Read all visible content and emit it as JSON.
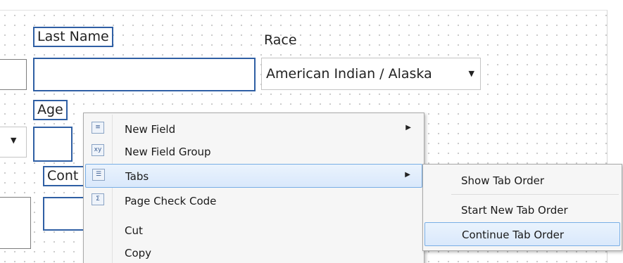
{
  "form": {
    "last_name_label": "Last Name",
    "race_label": "Race",
    "race_value": "American Indian / Alaska",
    "age_label": "Age",
    "contact_label_partial": "Cont"
  },
  "context_menu": {
    "items": [
      {
        "label": "New Field",
        "icon": "new-field-icon",
        "submenu": true
      },
      {
        "label": "New Field Group",
        "icon": "new-field-group-icon",
        "submenu": false
      },
      {
        "label": "Tabs",
        "icon": "tabs-icon",
        "submenu": true,
        "highlighted": true
      },
      {
        "label": "Page Check Code",
        "icon": "page-check-code-icon",
        "submenu": false
      },
      {
        "label": "Cut",
        "icon": "",
        "submenu": false
      },
      {
        "label": "Copy",
        "icon": "",
        "submenu": false
      }
    ]
  },
  "tabs_submenu": {
    "items": [
      {
        "label": "Show Tab Order"
      },
      {
        "label": "Start New Tab Order"
      },
      {
        "label": "Continue Tab Order",
        "highlighted": true
      }
    ]
  },
  "colors": {
    "selection_border": "#2f5fa4",
    "menu_highlight": "#d9e8fb",
    "menu_highlight_border": "#78aee5"
  }
}
